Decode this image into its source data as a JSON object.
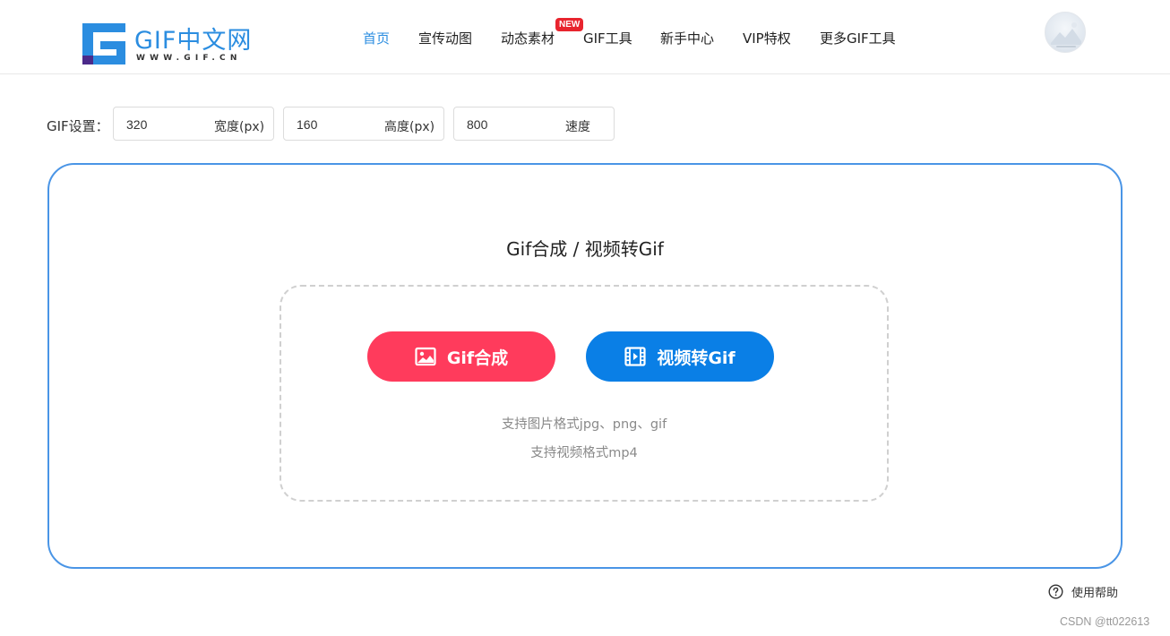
{
  "header": {
    "logo": {
      "text": "GIF中文网",
      "subtitle": "WWW.GIF.CN"
    },
    "nav": [
      {
        "label": "首页",
        "active": true
      },
      {
        "label": "宣传动图",
        "active": false
      },
      {
        "label": "动态素材",
        "active": false
      },
      {
        "label": "GIF工具",
        "active": false
      },
      {
        "label": "新手中心",
        "active": false
      },
      {
        "label": "VIP特权",
        "active": false
      },
      {
        "label": "更多GIF工具",
        "active": false
      }
    ],
    "new_badge": "NEW",
    "avatar_icon": "avatar-icon"
  },
  "settings": {
    "label": "GIF设置：",
    "width": {
      "value": "320",
      "unit": "宽度(px)"
    },
    "height": {
      "value": "160",
      "unit": "高度(px)"
    },
    "speed": {
      "value": "800",
      "unit": "速度"
    }
  },
  "panel": {
    "title": "Gif合成 / 视频转Gif",
    "buttons": {
      "gif": {
        "label": "Gif合成",
        "icon": "image-icon",
        "color": "#ff3b5c"
      },
      "video": {
        "label": "视频转Gif",
        "icon": "film-icon",
        "color": "#0a7fe6"
      }
    },
    "hints": [
      "支持图片格式jpg、png、gif",
      "支持视频格式mp4"
    ]
  },
  "help": {
    "label": "使用帮助",
    "icon": "question-circle-icon"
  },
  "watermark": "CSDN @tt022613",
  "colors": {
    "accent": "#2b8de0",
    "panel_border": "#4a95e6"
  }
}
